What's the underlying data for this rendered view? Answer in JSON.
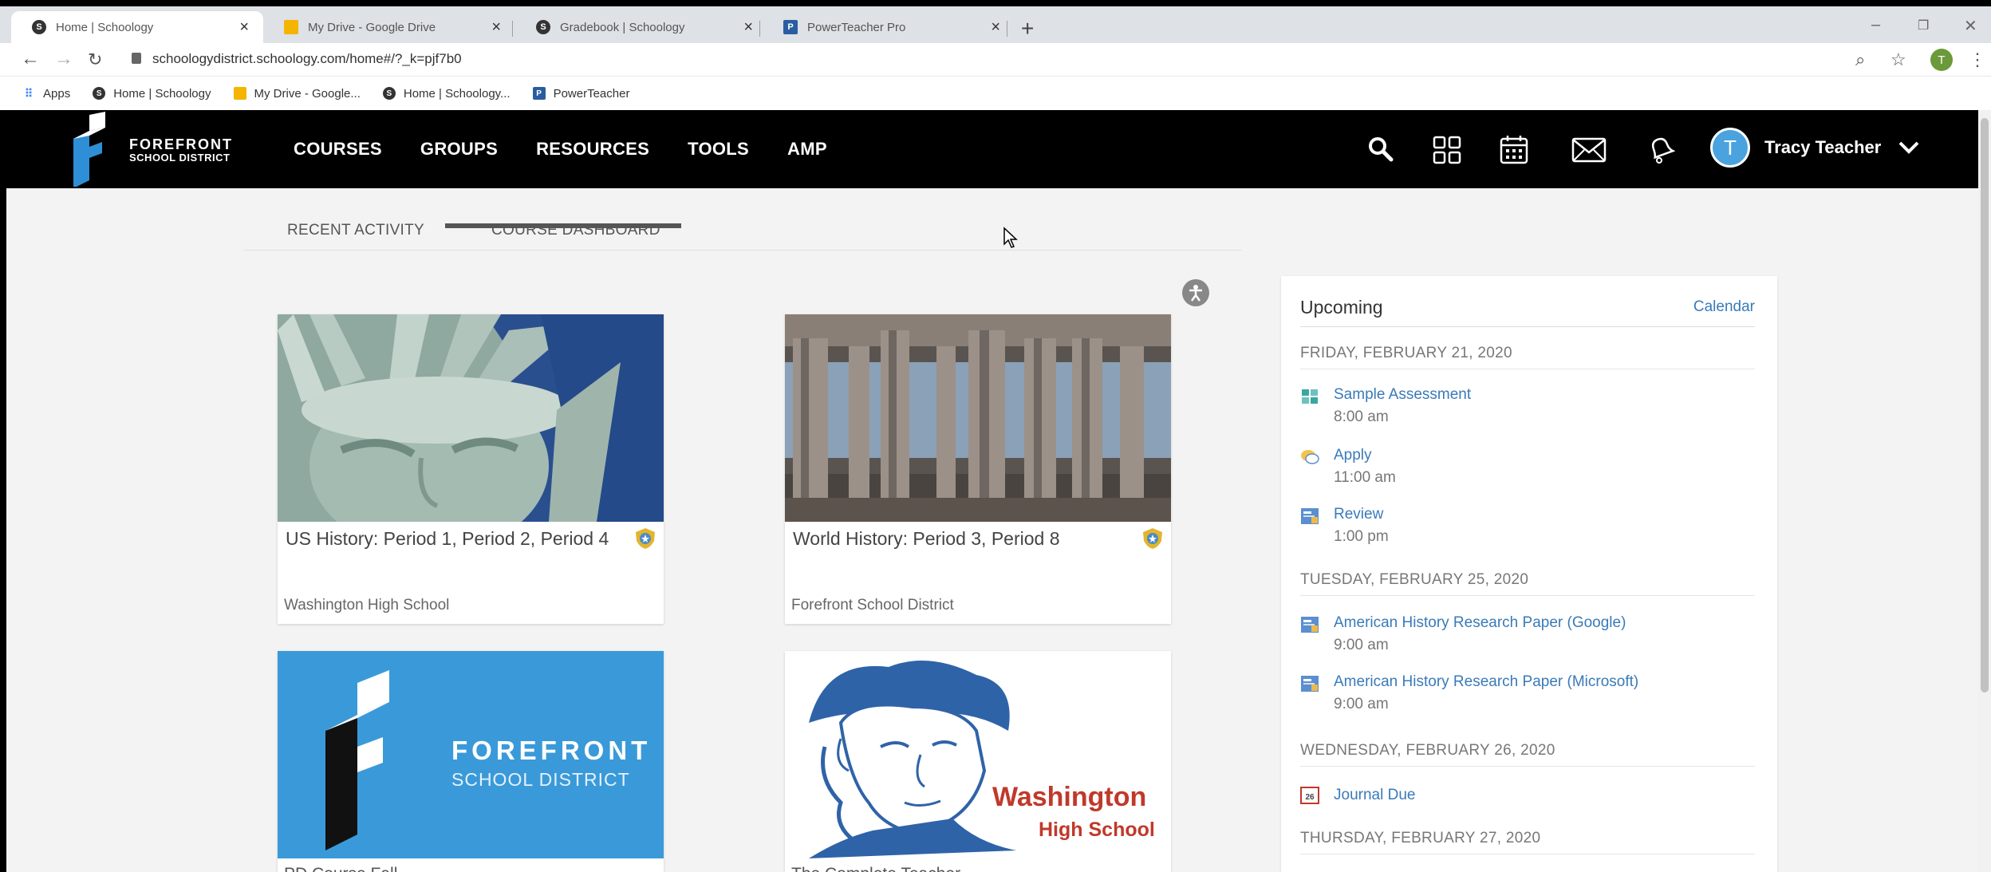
{
  "browser": {
    "tabs": [
      {
        "label": "Home | Schoology",
        "active": true
      },
      {
        "label": "My Drive - Google Drive",
        "active": false
      },
      {
        "label": "Gradebook | Schoology",
        "active": false
      },
      {
        "label": "PowerTeacher Pro",
        "active": false
      }
    ],
    "url": "schoologydistrict.schoology.com/home#/?_k=pjf7b0",
    "profile_initial": "T",
    "bookmarks": [
      {
        "label": "Apps"
      },
      {
        "label": "Home | Schoology"
      },
      {
        "label": "My Drive - Google..."
      },
      {
        "label": "Home | Schoology..."
      },
      {
        "label": "PowerTeacher"
      }
    ]
  },
  "header": {
    "logo_line1": "FOREFRONT",
    "logo_line2": "SCHOOL DISTRICT",
    "nav": [
      "COURSES",
      "GROUPS",
      "RESOURCES",
      "TOOLS",
      "AMP"
    ],
    "user_name": "Tracy Teacher",
    "user_initial": "T"
  },
  "subtabs": {
    "recent": "RECENT ACTIVITY",
    "dashboard": "COURSE DASHBOARD"
  },
  "courses": [
    {
      "title": "US History: Period 1, Period 2, Period 4",
      "school": "Washington High School"
    },
    {
      "title": "World History: Period 3, Period 8",
      "school": "Forefront School District"
    },
    {
      "title": "PD Course Fall",
      "image_text_1": "FOREFRONT",
      "image_text_2": "SCHOOL DISTRICT"
    },
    {
      "title": "The Complete Teacher",
      "image_text_1": "Washington",
      "image_text_2": "High School"
    }
  ],
  "upcoming": {
    "title": "Upcoming",
    "calendar_link": "Calendar",
    "days": [
      {
        "date": "FRIDAY, FEBRUARY 21, 2020",
        "events": [
          {
            "name": "Sample Assessment",
            "time": "8:00 am",
            "icon": "assessment-icon"
          },
          {
            "name": "Apply",
            "time": "11:00 am",
            "icon": "discussion-icon"
          },
          {
            "name": "Review",
            "time": "1:00 pm",
            "icon": "assignment-icon"
          }
        ]
      },
      {
        "date": "TUESDAY, FEBRUARY 25, 2020",
        "events": [
          {
            "name": "American History Research Paper (Google)",
            "time": "9:00 am",
            "icon": "assignment-icon"
          },
          {
            "name": "American History Research Paper (Microsoft)",
            "time": "9:00 am",
            "icon": "assignment-icon"
          }
        ]
      },
      {
        "date": "WEDNESDAY, FEBRUARY 26, 2020",
        "events": [
          {
            "name": "Journal Due",
            "icon": "calendar-event-icon",
            "icon_text": "26"
          }
        ]
      },
      {
        "date": "THURSDAY, FEBRUARY 27, 2020",
        "events": []
      }
    ]
  },
  "colors": {
    "header_bg": "#000000",
    "link": "#3a7ab8",
    "forefront_blue": "#3a9ad9",
    "washington_red": "#c0392b"
  }
}
